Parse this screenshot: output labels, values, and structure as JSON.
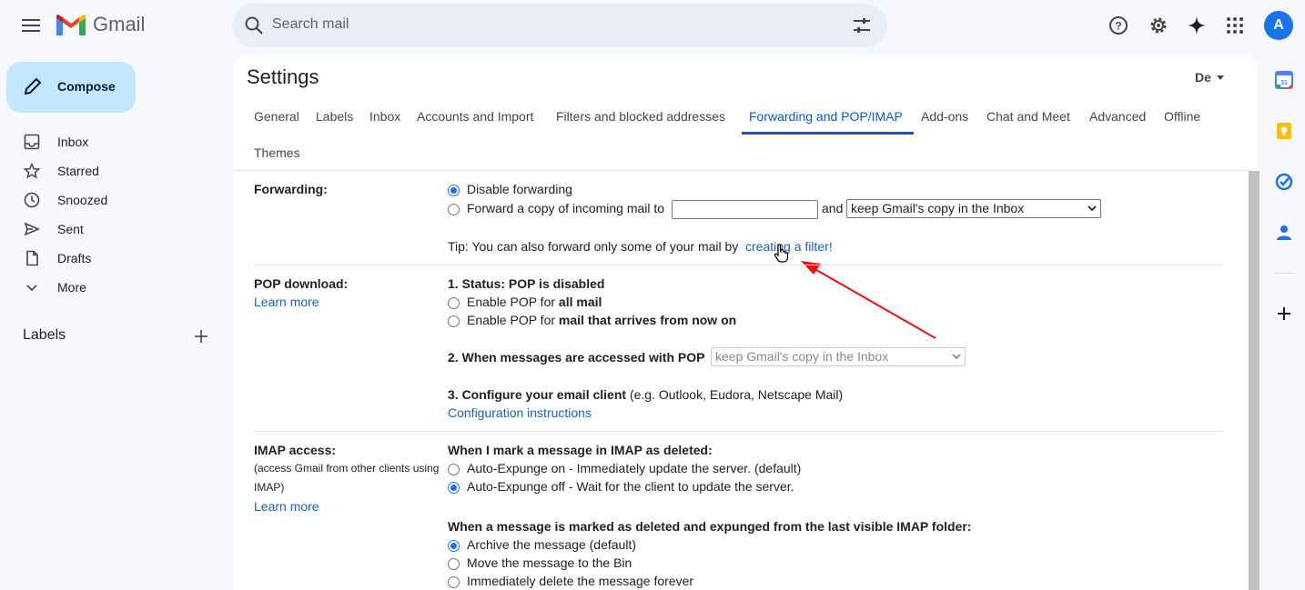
{
  "header": {
    "app_name": "Gmail",
    "search_placeholder": "Search mail",
    "avatar_letter": "A"
  },
  "nav": {
    "compose": "Compose",
    "items": [
      {
        "label": "Inbox",
        "icon": "inbox-icon"
      },
      {
        "label": "Starred",
        "icon": "star-icon"
      },
      {
        "label": "Snoozed",
        "icon": "clock-icon"
      },
      {
        "label": "Sent",
        "icon": "send-icon"
      },
      {
        "label": "Drafts",
        "icon": "draft-icon"
      },
      {
        "label": "More",
        "icon": "chevron-down-icon"
      }
    ],
    "labels_heading": "Labels"
  },
  "settings": {
    "title": "Settings",
    "lang": "De",
    "tabs": [
      "General",
      "Labels",
      "Inbox",
      "Accounts and Import",
      "Filters and blocked addresses",
      "Forwarding and POP/IMAP",
      "Add-ons",
      "Chat and Meet",
      "Advanced",
      "Offline",
      "Themes"
    ],
    "active_tab": "Forwarding and POP/IMAP"
  },
  "forwarding": {
    "label": "Forwarding:",
    "disable": "Disable forwarding",
    "forward_copy": "Forward a copy of incoming mail to",
    "and": "and",
    "keep_select": "keep Gmail's copy in the Inbox",
    "tip": "Tip: You can also forward only some of your mail by",
    "tip_link": "creating a filter!"
  },
  "pop": {
    "label": "POP download:",
    "learn_more": "Learn more",
    "status": "1. Status: POP is disabled",
    "enable_all_prefix": "Enable POP for",
    "enable_all_bold": "all mail",
    "enable_now_prefix": "Enable POP for",
    "enable_now_bold": "mail that arrives from now on",
    "accessed": "2. When messages are accessed with POP",
    "accessed_select": "keep Gmail's copy in the Inbox",
    "configure_bold": "3. Configure your email client",
    "configure_rest": "(e.g. Outlook, Eudora, Netscape Mail)",
    "config_link": "Configuration instructions"
  },
  "imap": {
    "label": "IMAP access:",
    "sub": "(access Gmail from other clients using IMAP)",
    "learn_more": "Learn more",
    "mark_deleted": "When I mark a message in IMAP as deleted:",
    "auto_on": "Auto-Expunge on - Immediately update the server. (default)",
    "auto_off": "Auto-Expunge off - Wait for the client to update the server.",
    "expunged": "When a message is marked as deleted and expunged from the last visible IMAP folder:",
    "archive": "Archive the message (default)",
    "move_bin": "Move the message to the Bin",
    "delete_forever": "Immediately delete the message forever"
  }
}
